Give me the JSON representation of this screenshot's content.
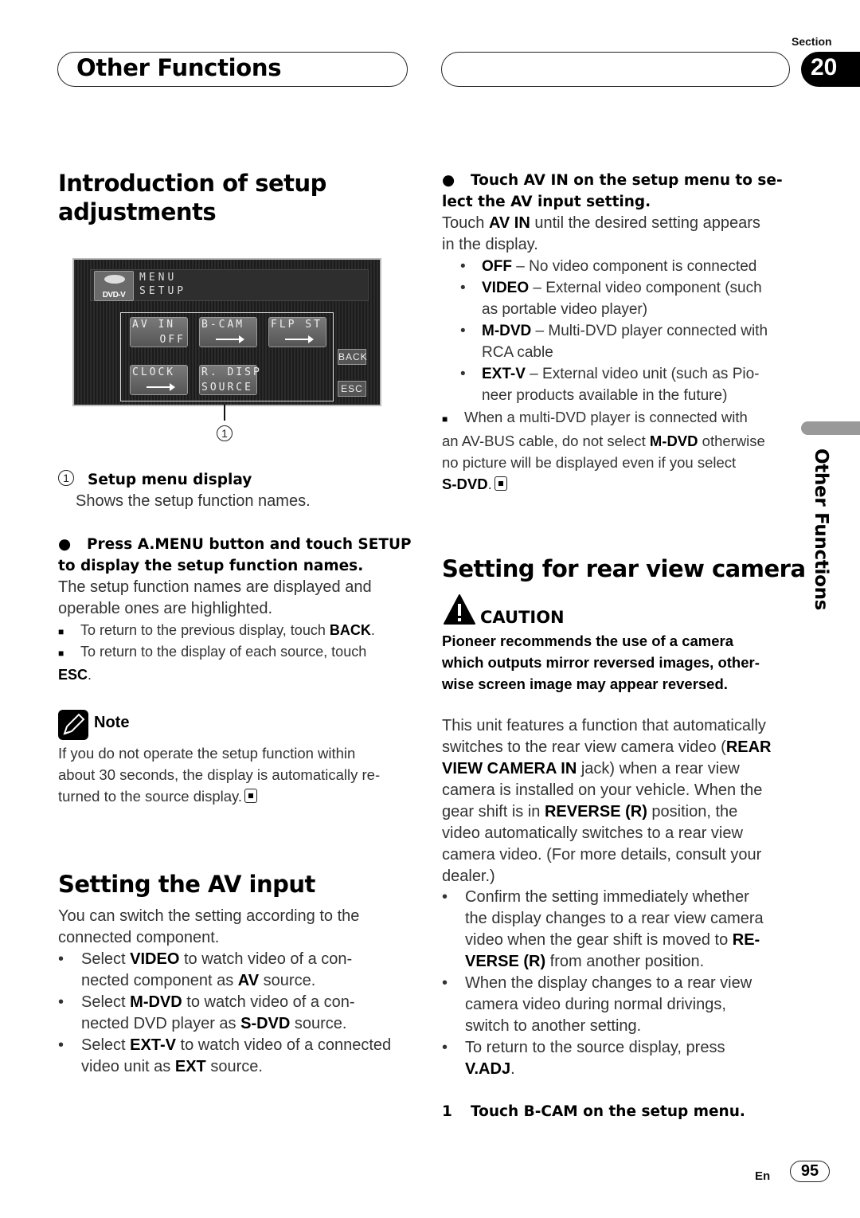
{
  "header": {
    "chapter_title": "Other Functions",
    "section_label": "Section",
    "section_number": "20"
  },
  "side_tab": {
    "label": "Other Functions"
  },
  "intro": {
    "title_line1": "Introduction of setup",
    "title_line2": "adjustments",
    "screen": {
      "source_icon_label": "DVD-V",
      "header_line1": "MENU",
      "header_line2": "SETUP",
      "buttons": [
        {
          "line1": "AV  IN",
          "line2": "OFF",
          "icon": ""
        },
        {
          "line1": "B-CAM",
          "line2": "",
          "icon": "arrow-right-icon"
        },
        {
          "line1": "FLP  ST",
          "line2": "",
          "icon": "arrow-right-icon"
        },
        {
          "line1": "CLOCK",
          "line2": "",
          "icon": "arrow-right-icon"
        },
        {
          "line1": "R. DISP",
          "line2": "SOURCE",
          "icon": ""
        }
      ],
      "back_label": "BACK",
      "esc_label": "ESC"
    },
    "callout_number": "1",
    "callout_title": "Setup menu display",
    "callout_desc": "Shows the setup function names.",
    "step_bold_1": "Press A.MENU button and touch SETUP",
    "step_bold_2": "to display the setup function names.",
    "step_desc_1": "The setup function names are displayed and",
    "step_desc_2": "operable ones are highlighted.",
    "tip1_text": "To return to the previous display, touch ",
    "tip1_bold": "BACK",
    "tip2_text": "To return to the display of each source, touch",
    "tip2_bold": "ESC"
  },
  "note": {
    "label": "Note",
    "line1": "If you do not operate the setup function within",
    "line2": "about 30 seconds, the display is automatically re-",
    "line3": "turned to the source display."
  },
  "av_input": {
    "title": "Setting the AV input",
    "intro_1": "You can switch the setting according to the",
    "intro_2": "connected component.",
    "bullets": [
      {
        "pre": "Select ",
        "bold": "VIDEO",
        "post": " to watch video of a con-",
        "line2_pre": "nected component as ",
        "line2_bold": "AV",
        "line2_post": " source."
      },
      {
        "pre": "Select ",
        "bold": "M-DVD",
        "post": " to watch video of a con-",
        "line2_pre": "nected DVD player as ",
        "line2_bold": "S-DVD",
        "line2_post": " source."
      },
      {
        "pre": "Select ",
        "bold": "EXT-V",
        "post": " to watch video of a connected",
        "line2_pre": "video unit as ",
        "line2_bold": "EXT",
        "line2_post": " source."
      }
    ],
    "step_bold_1": "Touch AV IN on the setup menu to se-",
    "step_bold_2": "lect the AV input setting.",
    "step_desc_pre": "Touch ",
    "step_desc_bold": "AV IN",
    "step_desc_post": " until the desired setting appears",
    "step_desc_2": "in the display.",
    "options": [
      {
        "bold": "OFF",
        "text": " – No video component is connected",
        "line2": ""
      },
      {
        "bold": "VIDEO",
        "text": " – External video component (such",
        "line2": "as portable video player)"
      },
      {
        "bold": "M-DVD",
        "text": " – Multi-DVD player connected with",
        "line2": "RCA cable"
      },
      {
        "bold": "EXT-V",
        "text": " – External video unit (such as Pio-",
        "line2": "neer products available in the future)"
      }
    ],
    "warn_1": "When a multi-DVD player is connected with",
    "warn_2_pre": "an AV-BUS cable, do not select ",
    "warn_2_bold": "M-DVD",
    "warn_2_post": " otherwise",
    "warn_3": "no picture will be displayed even if you select",
    "warn_4_bold": "S-DVD"
  },
  "rear_camera": {
    "title": "Setting for rear view camera",
    "caution_label": "CAUTION",
    "caution_1": "Pioneer recommends the use of a camera",
    "caution_2": "which outputs mirror reversed images, other-",
    "caution_3": "wise screen image may appear reversed.",
    "p1": "This unit features a function that automatically",
    "p2_pre": "switches to the rear view camera video (",
    "p2_bold": "REAR",
    "p3_bold": "VIEW CAMERA IN",
    "p3_post": " jack) when a rear view",
    "p4": "camera is installed on your vehicle. When the",
    "p5_pre": "gear shift is in ",
    "p5_bold": "REVERSE (R)",
    "p5_post": " position, the",
    "p6": "video automatically switches to a rear view",
    "p7": "camera video. (For more details, consult your",
    "p8": "dealer.)",
    "b1_1": "Confirm the setting immediately whether",
    "b1_2": "the display changes to a rear view camera",
    "b1_3_pre": "video when the gear shift is moved to ",
    "b1_3_bold": "RE-",
    "b1_4_bold": "VERSE (R)",
    "b1_4_post": " from another position.",
    "b2_1": "When the display changes to a rear view",
    "b2_2": "camera video during normal drivings,",
    "b2_3": "switch to another setting.",
    "b3_1": "To return to the source display, press",
    "b3_2_bold": "V.ADJ",
    "step_num": "1",
    "step_text": "Touch B-CAM on the setup menu."
  },
  "footer": {
    "lang": "En",
    "page": "95"
  }
}
